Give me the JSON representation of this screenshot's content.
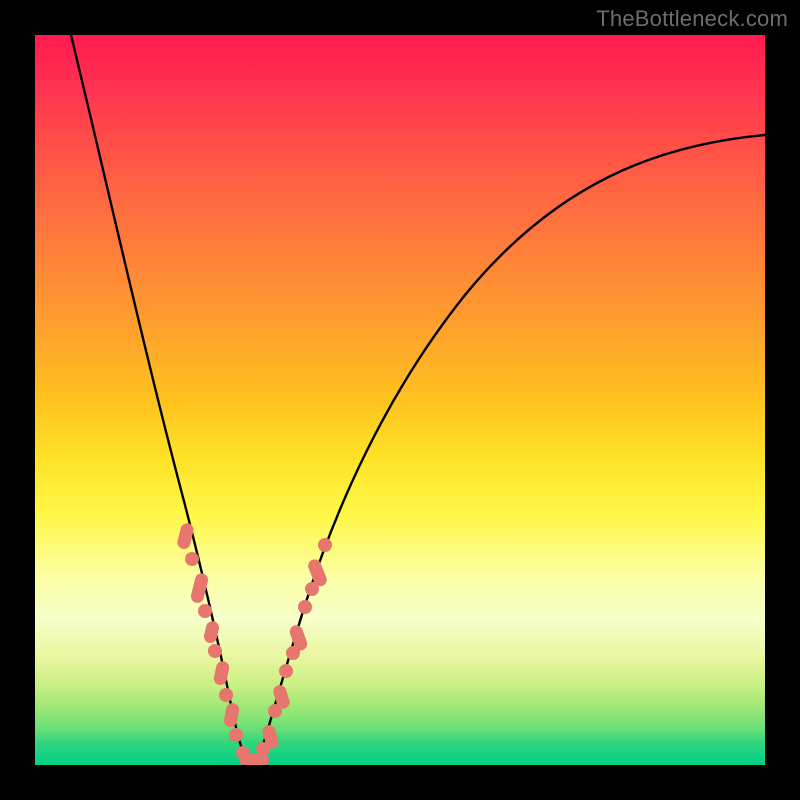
{
  "attribution": "TheBottleneck.com",
  "colors": {
    "dot": "#e7766f",
    "curve": "#000000"
  },
  "chart_data": {
    "type": "line",
    "title": "",
    "xlabel": "",
    "ylabel": "",
    "xlim": [
      0,
      100
    ],
    "ylim": [
      0,
      100
    ],
    "note": "Values are visual estimates in percent of plot width/height; no axes or ticks are rendered in the image.",
    "series": [
      {
        "name": "left-curve",
        "x": [
          5,
          8,
          12,
          15,
          18,
          20,
          22,
          24,
          25,
          26,
          27,
          28
        ],
        "y": [
          100,
          85,
          65,
          50,
          38,
          28,
          20,
          12,
          8,
          5,
          2,
          0
        ]
      },
      {
        "name": "right-curve",
        "x": [
          30,
          32,
          34,
          36,
          40,
          46,
          55,
          65,
          78,
          90,
          100
        ],
        "y": [
          0,
          6,
          12,
          19,
          30,
          42,
          55,
          66,
          76,
          82,
          86
        ]
      }
    ],
    "markers": {
      "name": "highlight-points",
      "comment": "salmon dots/capsules along lower V-section",
      "points": [
        {
          "x": 20.5,
          "y": 32
        },
        {
          "x": 21.5,
          "y": 28
        },
        {
          "x": 22.5,
          "y": 23.5
        },
        {
          "x": 23.0,
          "y": 21
        },
        {
          "x": 23.8,
          "y": 17
        },
        {
          "x": 24.2,
          "y": 14.5
        },
        {
          "x": 25.0,
          "y": 11
        },
        {
          "x": 25.7,
          "y": 8
        },
        {
          "x": 26.4,
          "y": 5
        },
        {
          "x": 27.0,
          "y": 3
        },
        {
          "x": 28.0,
          "y": 1.5
        },
        {
          "x": 29.5,
          "y": 1.2
        },
        {
          "x": 31.0,
          "y": 2.5
        },
        {
          "x": 32.0,
          "y": 5.5
        },
        {
          "x": 33.0,
          "y": 9
        },
        {
          "x": 34.0,
          "y": 13
        },
        {
          "x": 34.8,
          "y": 16.5
        },
        {
          "x": 35.5,
          "y": 19.5
        },
        {
          "x": 36.5,
          "y": 23
        },
        {
          "x": 37.5,
          "y": 26.5
        },
        {
          "x": 38.5,
          "y": 30
        }
      ]
    }
  }
}
